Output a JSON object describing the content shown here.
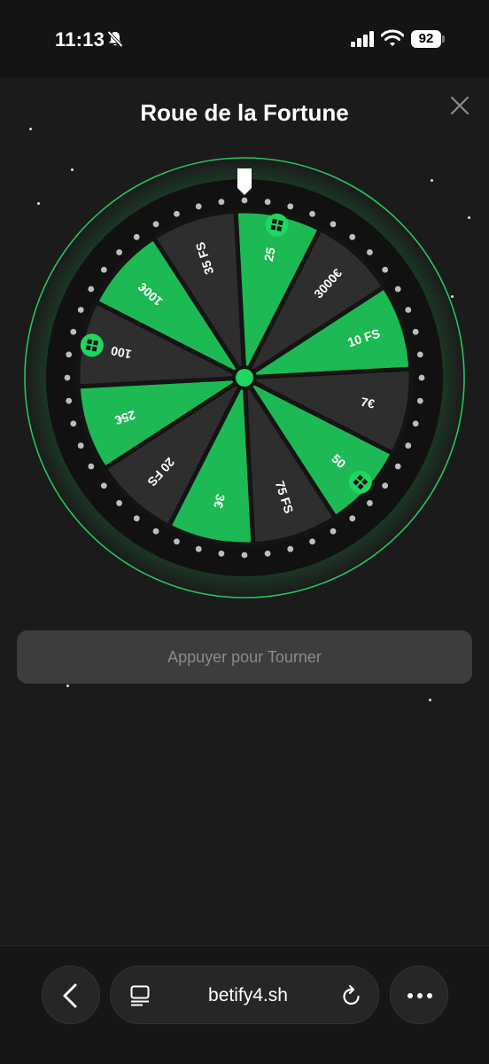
{
  "status": {
    "time": "11:13",
    "battery": "92"
  },
  "modal": {
    "title": "Roue de la Fortune",
    "spin_label": "Appuyer pour Tourner"
  },
  "wheel": {
    "colors": {
      "green": "#1db954",
      "dark": "#2e2e2e",
      "rim": "#111111",
      "accent": "#23c45e"
    },
    "segments": [
      {
        "label": "25",
        "icon": "coin-icon",
        "color": "green"
      },
      {
        "label": "3000€",
        "color": "dark"
      },
      {
        "label": "10 FS",
        "color": "green"
      },
      {
        "label": "7€",
        "color": "dark"
      },
      {
        "label": "50",
        "icon": "coin-icon",
        "color": "green"
      },
      {
        "label": "75 FS",
        "color": "dark"
      },
      {
        "label": "3€",
        "color": "green"
      },
      {
        "label": "20 FS",
        "color": "dark"
      },
      {
        "label": "25€",
        "color": "green"
      },
      {
        "label": "100",
        "icon": "coin-icon",
        "color": "dark"
      },
      {
        "label": "100€",
        "color": "green"
      },
      {
        "label": "35 FS",
        "color": "dark"
      }
    ]
  },
  "browser": {
    "url": "betify4.sh"
  }
}
